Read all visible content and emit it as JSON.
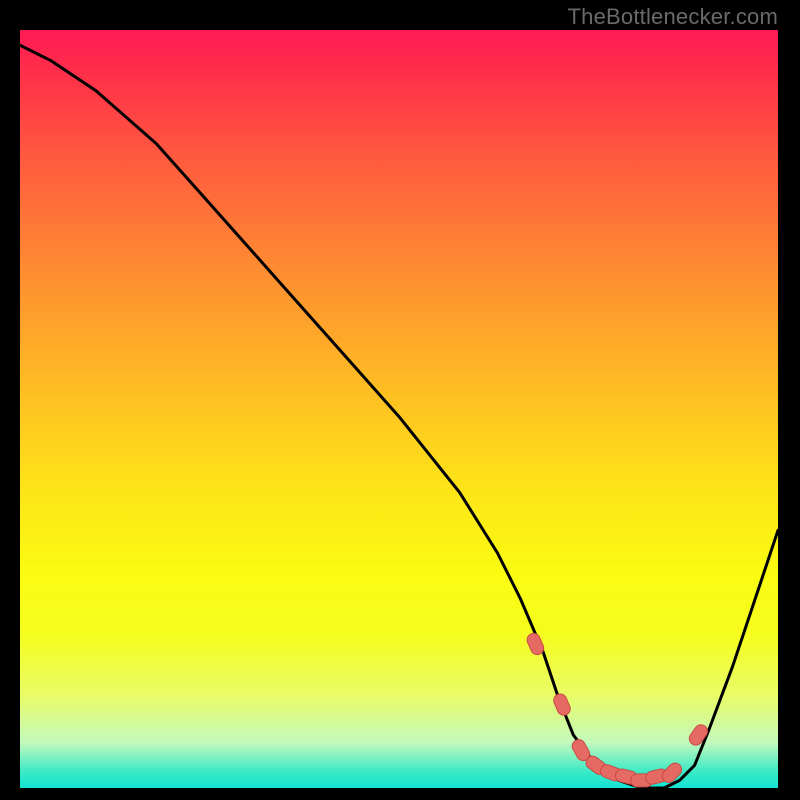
{
  "watermark": "TheBottlenecker.com",
  "chart_data": {
    "type": "line",
    "title": "",
    "xlabel": "",
    "ylabel": "",
    "xlim": [
      0,
      100
    ],
    "ylim": [
      0,
      100
    ],
    "grid": false,
    "series": [
      {
        "name": "bottleneck-curve",
        "x": [
          0,
          4,
          10,
          18,
          26,
          34,
          42,
          50,
          58,
          63,
          66,
          69,
          71,
          73,
          76,
          79,
          82,
          85,
          87,
          89,
          91,
          94,
          97,
          100
        ],
        "y": [
          98,
          96,
          92,
          85,
          76,
          67,
          58,
          49,
          39,
          31,
          25,
          18,
          12,
          7,
          3,
          1,
          0,
          0,
          1,
          3,
          8,
          16,
          25,
          34
        ]
      }
    ],
    "markers": {
      "name": "optimum-zone",
      "x": [
        68,
        71.5,
        74,
        76,
        78,
        80,
        82,
        84,
        86,
        89.5
      ],
      "y": [
        19,
        11,
        5,
        3,
        2,
        1.5,
        1,
        1.5,
        2,
        7
      ]
    },
    "colors": {
      "curve": "#000000",
      "marker_fill": "#e46a63",
      "marker_stroke": "#c94a45"
    }
  }
}
